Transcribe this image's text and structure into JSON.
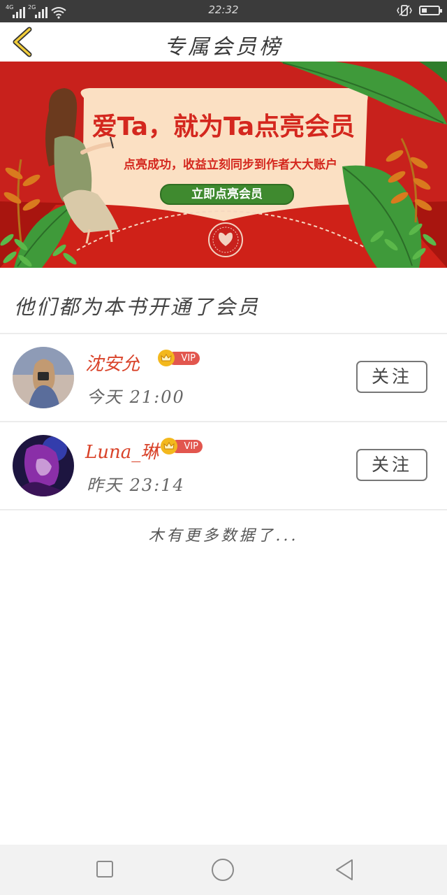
{
  "status_bar": {
    "time": "22:32",
    "network_1": "4G",
    "network_2": "2G",
    "icons": [
      "signal-icon",
      "signal-icon",
      "wifi-icon",
      "vibrate-icon",
      "battery-icon"
    ]
  },
  "header": {
    "title": "专属会员榜",
    "back_icon": "chevron-left-icon"
  },
  "banner": {
    "headline": "爱Ta，就为Ta点亮会员",
    "subtitle": "点亮成功，收益立刻同步到作者大大账户",
    "cta_label": "立即点亮会员",
    "colors": {
      "background": "#c8211c",
      "card": "#fbe0c3",
      "cta": "#3f8a2f",
      "leaf": "#3f9a3a"
    }
  },
  "section_title": "他们都为本书开通了会员",
  "members": [
    {
      "name": "沈安允",
      "badge": "VIP",
      "time": "今天 21:00",
      "follow_label": "关注"
    },
    {
      "name": "Luna_琳",
      "badge": "VIP",
      "time": "昨天 23:14",
      "follow_label": "关注"
    }
  ],
  "no_more_text": "木有更多数据了...",
  "bottom_nav": {
    "icons": [
      "recent-apps-icon",
      "home-icon",
      "back-triangle-icon"
    ]
  }
}
